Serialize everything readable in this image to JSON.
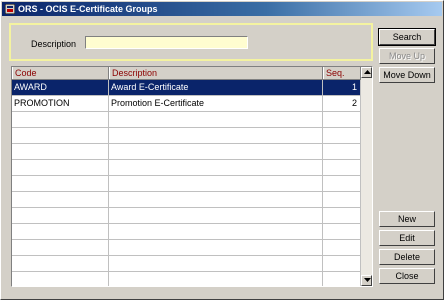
{
  "window": {
    "title": "ORS - OCIS E-Certificate Groups"
  },
  "filter": {
    "description_label": "Description",
    "description_value": ""
  },
  "grid": {
    "headers": {
      "code": "Code",
      "description": "Description",
      "seq": "Seq."
    },
    "rows": [
      {
        "code": "AWARD",
        "description": "Award E-Certificate",
        "seq": "1",
        "selected": true
      },
      {
        "code": "PROMOTION",
        "description": "Promotion E-Certificate",
        "seq": "2",
        "selected": false
      }
    ],
    "empty_row_count": 11
  },
  "buttons": {
    "search": "Search",
    "move_up": "Move Up",
    "move_down": "Move Down",
    "new": "New",
    "edit": "Edit",
    "delete": "Delete",
    "close": "Close"
  },
  "icons": {
    "app": "window-app-icon",
    "scroll_up": "arrow-up-icon",
    "scroll_down": "arrow-down-icon"
  },
  "colors": {
    "title_start": "#0a246a",
    "selection": "#0a246a",
    "header_text": "#8b0000",
    "input_bg": "#fffdd0",
    "panel_border": "#f4f3a0"
  }
}
